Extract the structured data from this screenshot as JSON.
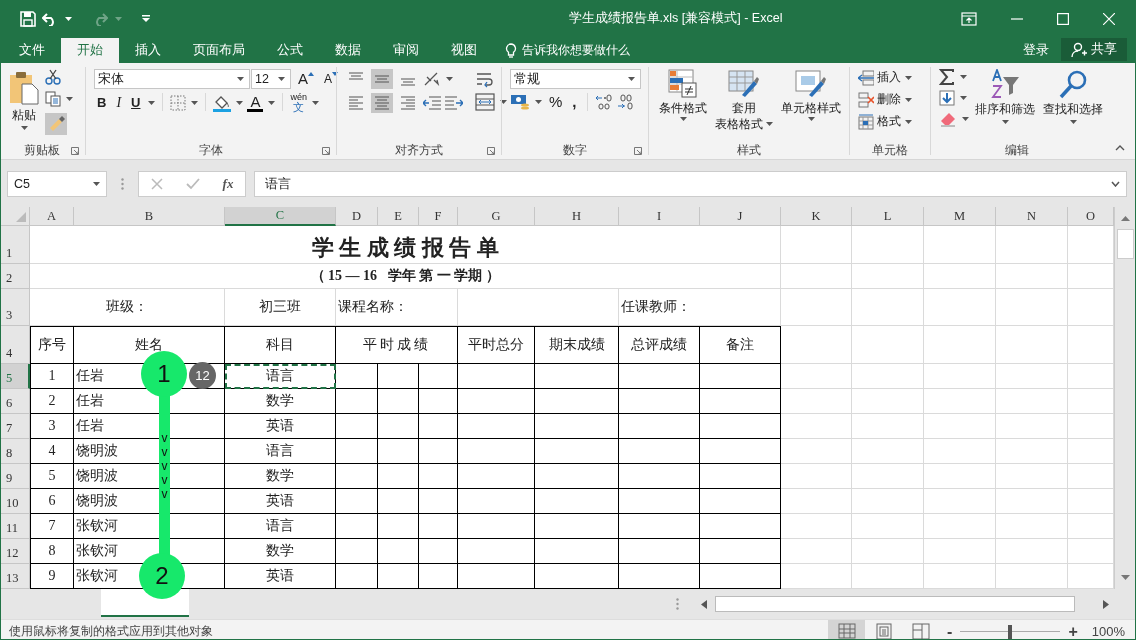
{
  "window": {
    "title": "学生成绩报告单.xls  [兼容模式] - Excel",
    "redo_disabled": true
  },
  "tabs": [
    {
      "label": "文件",
      "selected": false
    },
    {
      "label": "开始",
      "selected": true
    },
    {
      "label": "插入",
      "selected": false
    },
    {
      "label": "页面布局",
      "selected": false
    },
    {
      "label": "公式",
      "selected": false
    },
    {
      "label": "数据",
      "selected": false
    },
    {
      "label": "审阅",
      "selected": false
    },
    {
      "label": "视图",
      "selected": false
    }
  ],
  "tell_me": "告诉我你想要做什么",
  "sign_in": "登录",
  "share": "共享",
  "ribbon": {
    "clipboard": {
      "paste": "粘贴",
      "format_painter_active": true,
      "label": "剪贴板"
    },
    "font": {
      "name": "宋体",
      "size": "12",
      "grow": "A",
      "shrink": "A",
      "bold": "B",
      "italic": "I",
      "underline": "U",
      "font_color": "A",
      "phonetic_top": "wén",
      "phonetic_bottom": "文",
      "label": "字体"
    },
    "alignment": {
      "vertical": [
        {
          "kind": "top",
          "selected": false
        },
        {
          "kind": "middle",
          "selected": true
        },
        {
          "kind": "bottom",
          "selected": false
        }
      ],
      "horizontal": [
        {
          "kind": "left",
          "selected": false
        },
        {
          "kind": "center",
          "selected": true
        },
        {
          "kind": "right",
          "selected": false
        }
      ],
      "label": "对齐方式"
    },
    "number": {
      "format": "常规",
      "percent": "%",
      "comma": ",",
      "label": "数字"
    },
    "styles": {
      "buttons": [
        {
          "kind": "conditional",
          "lines": [
            "条件格式"
          ]
        },
        {
          "kind": "table",
          "lines": [
            "套用",
            "表格格式"
          ]
        },
        {
          "kind": "cell",
          "lines": [
            "单元格样式"
          ]
        }
      ],
      "label": "样式"
    },
    "cells": {
      "buttons": [
        {
          "kind": "insert",
          "label": "插入"
        },
        {
          "kind": "delete",
          "label": "删除"
        },
        {
          "kind": "format",
          "label": "格式"
        }
      ],
      "label": "单元格"
    },
    "editing": {
      "sort": "排序和筛选",
      "find": "查找和选择",
      "label": "编辑"
    }
  },
  "formula_bar": {
    "name_box": "C5",
    "fx": "fx",
    "value": "语言"
  },
  "sheet": {
    "columns": [
      {
        "label": "A",
        "selected": false
      },
      {
        "label": "B",
        "selected": false
      },
      {
        "label": "C",
        "selected": true
      },
      {
        "label": "D",
        "selected": false
      },
      {
        "label": "E",
        "selected": false
      },
      {
        "label": "F",
        "selected": false
      },
      {
        "label": "G",
        "selected": false
      },
      {
        "label": "H",
        "selected": false
      },
      {
        "label": "I",
        "selected": false
      },
      {
        "label": "J",
        "selected": false
      },
      {
        "label": "K",
        "selected": false
      },
      {
        "label": "L",
        "selected": false
      },
      {
        "label": "M",
        "selected": false
      },
      {
        "label": "N",
        "selected": false
      },
      {
        "label": "O",
        "selected": false
      }
    ],
    "row_numbers": [
      {
        "label": "1",
        "selected": false
      },
      {
        "label": "2",
        "selected": false
      },
      {
        "label": "3",
        "selected": false
      },
      {
        "label": "4",
        "selected": false
      },
      {
        "label": "5",
        "selected": true
      },
      {
        "label": "6",
        "selected": false
      },
      {
        "label": "7",
        "selected": false
      },
      {
        "label": "8",
        "selected": false
      },
      {
        "label": "9",
        "selected": false
      },
      {
        "label": "10",
        "selected": false
      },
      {
        "label": "11",
        "selected": false
      },
      {
        "label": "12",
        "selected": false
      },
      {
        "label": "13",
        "selected": false
      }
    ],
    "title": "学 生 成 绩 报 告 单",
    "subtitle": "（ 15 — 16   学年 第 一 学期 ）",
    "class_label": "班级：",
    "class_value": "初三班",
    "course_label": "课程名称：",
    "teacher_label": "任课教师：",
    "headers": [
      "序号",
      "姓名",
      "科目",
      "平时成绩",
      "平时总分",
      "期末成绩",
      "总评成绩",
      "备注"
    ],
    "records": [
      {
        "no": "1",
        "name": "任岩",
        "subject": "语言",
        "selected": true
      },
      {
        "no": "2",
        "name": "任岩",
        "subject": "数学",
        "selected": false
      },
      {
        "no": "3",
        "name": "任岩",
        "subject": "英语",
        "selected": false
      },
      {
        "no": "4",
        "name": "饶明波",
        "subject": "语言",
        "selected": false
      },
      {
        "no": "5",
        "name": "饶明波",
        "subject": "数学",
        "selected": false
      },
      {
        "no": "6",
        "name": "饶明波",
        "subject": "英语",
        "selected": false
      },
      {
        "no": "7",
        "name": "张钦河",
        "subject": "语言",
        "selected": false
      },
      {
        "no": "8",
        "name": "张钦河",
        "subject": "数学",
        "selected": false
      },
      {
        "no": "9",
        "name": "张钦河",
        "subject": "英语",
        "selected": false
      }
    ]
  },
  "overlay": {
    "start": "1",
    "end": "2",
    "count": "12",
    "marks": [
      "v",
      "v",
      "v",
      "v",
      "v"
    ]
  },
  "status_bar": {
    "message": "使用鼠标将复制的格式应用到其他对象",
    "views": [
      {
        "kind": "normal",
        "selected": true
      },
      {
        "kind": "page_layout",
        "selected": false
      },
      {
        "kind": "page_break",
        "selected": false
      }
    ],
    "zoom_out": "-",
    "zoom_in": "+",
    "zoom_slider": {
      "level": 0.5
    },
    "zoom": "100%"
  }
}
